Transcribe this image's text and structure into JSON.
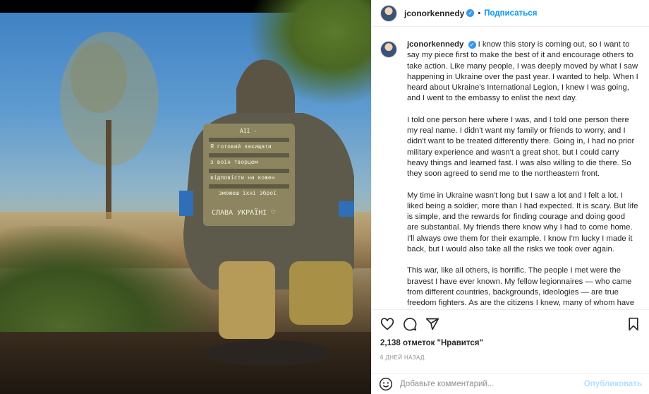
{
  "post": {
    "username": "jconorkennedy",
    "subscribe_label": "Подписаться",
    "dot": "•",
    "verified_mark": "✓"
  },
  "photo": {
    "patch_lines": [
      "Я готовий захищати",
      "з воїн творцем",
      "відповісти на кожен",
      "зможеш їхні зброї",
      "СЛАВА УКРАЇНІ ♡"
    ]
  },
  "caption": {
    "username": "jconorkennedy",
    "paragraphs": [
      "I know this story is coming out, so I want to say my piece first to make the best of it and encourage others to take action. Like many people, I was deeply moved by what I saw happening in Ukraine over the past year. I wanted to help. When I heard about Ukraine's International Legion, I knew I was going, and I went to the embassy to enlist the next day.",
      "I told one person here where I was, and I told one person there my real name. I didn't want my family or friends to worry, and I didn't want to be treated differently there. Going in, I had no prior military experience and wasn't a great shot, but I could carry heavy things and learned fast. I was also willing to die there. So they soon agreed to send me to the northeastern front.",
      "My time in Ukraine wasn't long but I saw a lot and I felt a lot. I liked being a soldier, more than I had expected. It is scary. But life is simple, and the rewards for finding courage and doing good are substantial. My friends there know why I had to come home. I'll always owe them for their example. I know I'm lucky I made it back, but I would also take all the risks we took over again.",
      "This war, like all others, is horrific. The people I met were the bravest I have ever known. My fellow legionnaires — who came from different countries, backgrounds, ideologies — are true freedom fighters. As are the citizens I knew, many of whom have"
    ]
  },
  "stats": {
    "likes": "2,138 отметок \"Нравится\"",
    "time": "6 ДНЕЙ НАЗАД"
  },
  "comment_box": {
    "placeholder": "Добавьте комментарий...",
    "publish_label": "Опубликовать"
  }
}
